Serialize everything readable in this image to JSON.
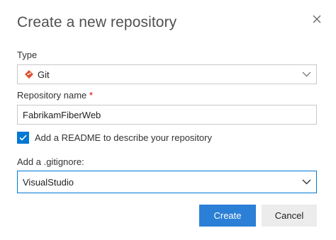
{
  "dialog": {
    "title": "Create a new repository",
    "close_icon": "close-icon"
  },
  "type_field": {
    "label": "Type",
    "value": "Git",
    "icon": "git-icon",
    "icon_color": "#e04e2a"
  },
  "name_field": {
    "label": "Repository name",
    "required_marker": "*",
    "value": "FabrikamFiberWeb"
  },
  "readme": {
    "checked": true,
    "label": "Add a README to describe your repository"
  },
  "gitignore_field": {
    "label": "Add a .gitignore:",
    "value": "VisualStudio"
  },
  "actions": {
    "create_label": "Create",
    "cancel_label": "Cancel"
  },
  "colors": {
    "accent": "#0078d4",
    "primary_button": "#2b7fd6",
    "secondary_button": "#ececec"
  }
}
